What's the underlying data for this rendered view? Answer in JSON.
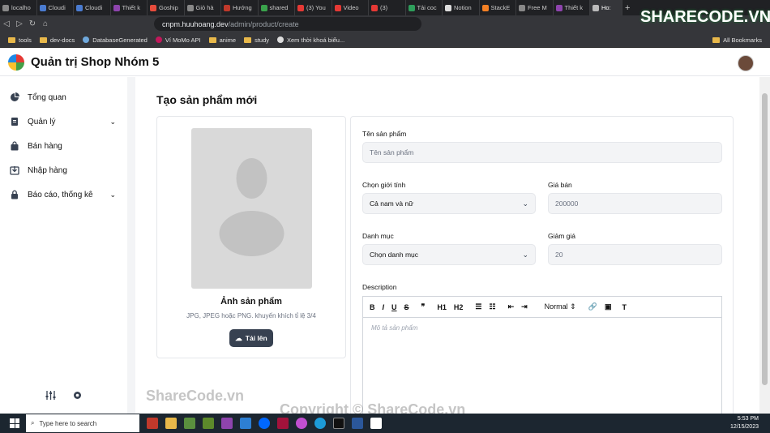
{
  "browser": {
    "tabs": [
      "localho",
      "Cloudi",
      "Cloudi",
      "Thiết k",
      "Goship",
      "Giỏ hà",
      "Hướng",
      "shared",
      "(3) You",
      "Video",
      "(3)",
      "Tải coc",
      "Notion",
      "StackE",
      "Free M",
      "Thiết k",
      "Ho:"
    ],
    "new_tab": "+",
    "url_domain": "cnpm.huuhoang.dev",
    "url_path": "/admin/product/create",
    "bookmarks": [
      "tools",
      "dev-docs",
      "DatabaseGenerated",
      "Ví MoMo API",
      "anime",
      "study",
      "Xem thời khoá biểu..."
    ],
    "all_bookmarks": "All Bookmarks"
  },
  "app": {
    "title": "Quản trị Shop Nhóm 5"
  },
  "sidebar": {
    "items": [
      {
        "label": "Tổng quan",
        "icon": "pie-chart-icon",
        "expandable": false
      },
      {
        "label": "Quản lý",
        "icon": "document-icon",
        "expandable": true
      },
      {
        "label": "Bán hàng",
        "icon": "shopping-bag-icon",
        "expandable": false
      },
      {
        "label": "Nhập hàng",
        "icon": "import-icon",
        "expandable": false
      },
      {
        "label": "Báo cáo, thống kê",
        "icon": "lock-icon",
        "expandable": true
      }
    ]
  },
  "page": {
    "title": "Tạo sản phẩm mới"
  },
  "image_card": {
    "caption": "Ảnh sản phẩm",
    "hint": "JPG, JPEG hoặc PNG. khuyến khích tỉ lệ 3/4",
    "upload_label": "Tải lên"
  },
  "form": {
    "name_label": "Tên sản phẩm",
    "name_placeholder": "Tên sản phẩm",
    "gender_label": "Chọn giới tính",
    "gender_value": "Cả nam và nữ",
    "price_label": "Giá bán",
    "price_placeholder": "200000",
    "category_label": "Danh mục",
    "category_value": "Chọn danh mục",
    "discount_label": "Giảm giá",
    "discount_placeholder": "20",
    "description_label": "Description",
    "editor_placeholder": "Mô tả sản phẩm",
    "toolbar": {
      "bold": "B",
      "italic": "I",
      "underline": "U",
      "strike": "S",
      "quote": "❞",
      "h1": "H1",
      "h2": "H2",
      "format": "Normal",
      "clear": "T"
    }
  },
  "taskbar": {
    "search_placeholder": "Type here to search",
    "time": "5:53 PM",
    "date": "12/15/2023"
  },
  "watermarks": {
    "a": "ShareCode.vn",
    "b": "Copyright © ShareCode.vn",
    "brand": "SHARECODE.VN"
  }
}
